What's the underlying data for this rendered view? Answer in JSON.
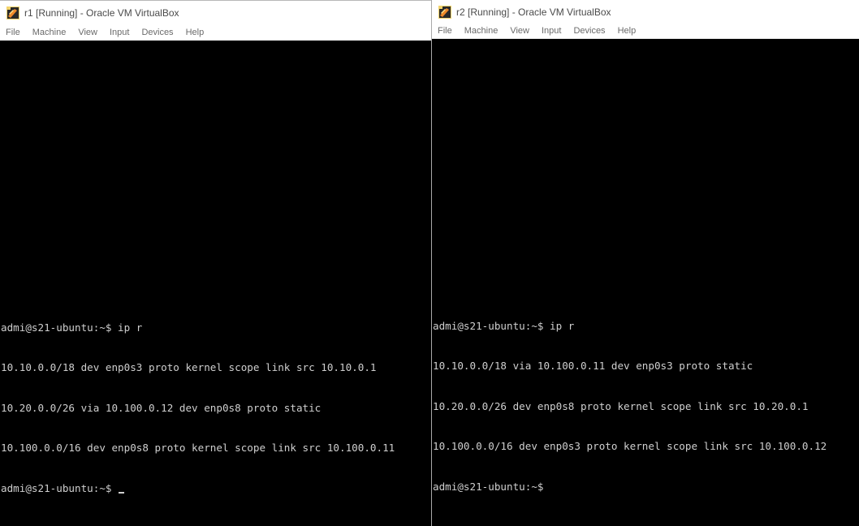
{
  "windows": [
    {
      "title": "r1 [Running] - Oracle VM VirtualBox",
      "menu": [
        "File",
        "Machine",
        "View",
        "Input",
        "Devices",
        "Help"
      ],
      "console_lines": [
        "admi@s21-ubuntu:~$ ip r",
        "10.10.0.0/18 dev enp0s3 proto kernel scope link src 10.10.0.1",
        "10.20.0.0/26 via 10.100.0.12 dev enp0s8 proto static",
        "10.100.0.0/16 dev enp0s8 proto kernel scope link src 10.100.0.11",
        "admi@s21-ubuntu:~$ "
      ]
    },
    {
      "title": "r2 [Running] - Oracle VM VirtualBox",
      "menu": [
        "File",
        "Machine",
        "View",
        "Input",
        "Devices",
        "Help"
      ],
      "console_lines": [
        "admi@s21-ubuntu:~$ ip r",
        "10.10.0.0/18 via 10.100.0.11 dev enp0s3 proto static",
        "10.20.0.0/26 dev enp0s8 proto kernel scope link src 10.20.0.1",
        "10.100.0.0/16 dev enp0s3 proto kernel scope link src 10.100.0.12",
        "admi@s21-ubuntu:~$"
      ]
    }
  ],
  "colors": {
    "console_text": "#cfcfcf",
    "console_bg": "#000000",
    "titlebar_bg": "#ffffff"
  },
  "icons": {
    "app_icon": "virtualbox-icon"
  }
}
